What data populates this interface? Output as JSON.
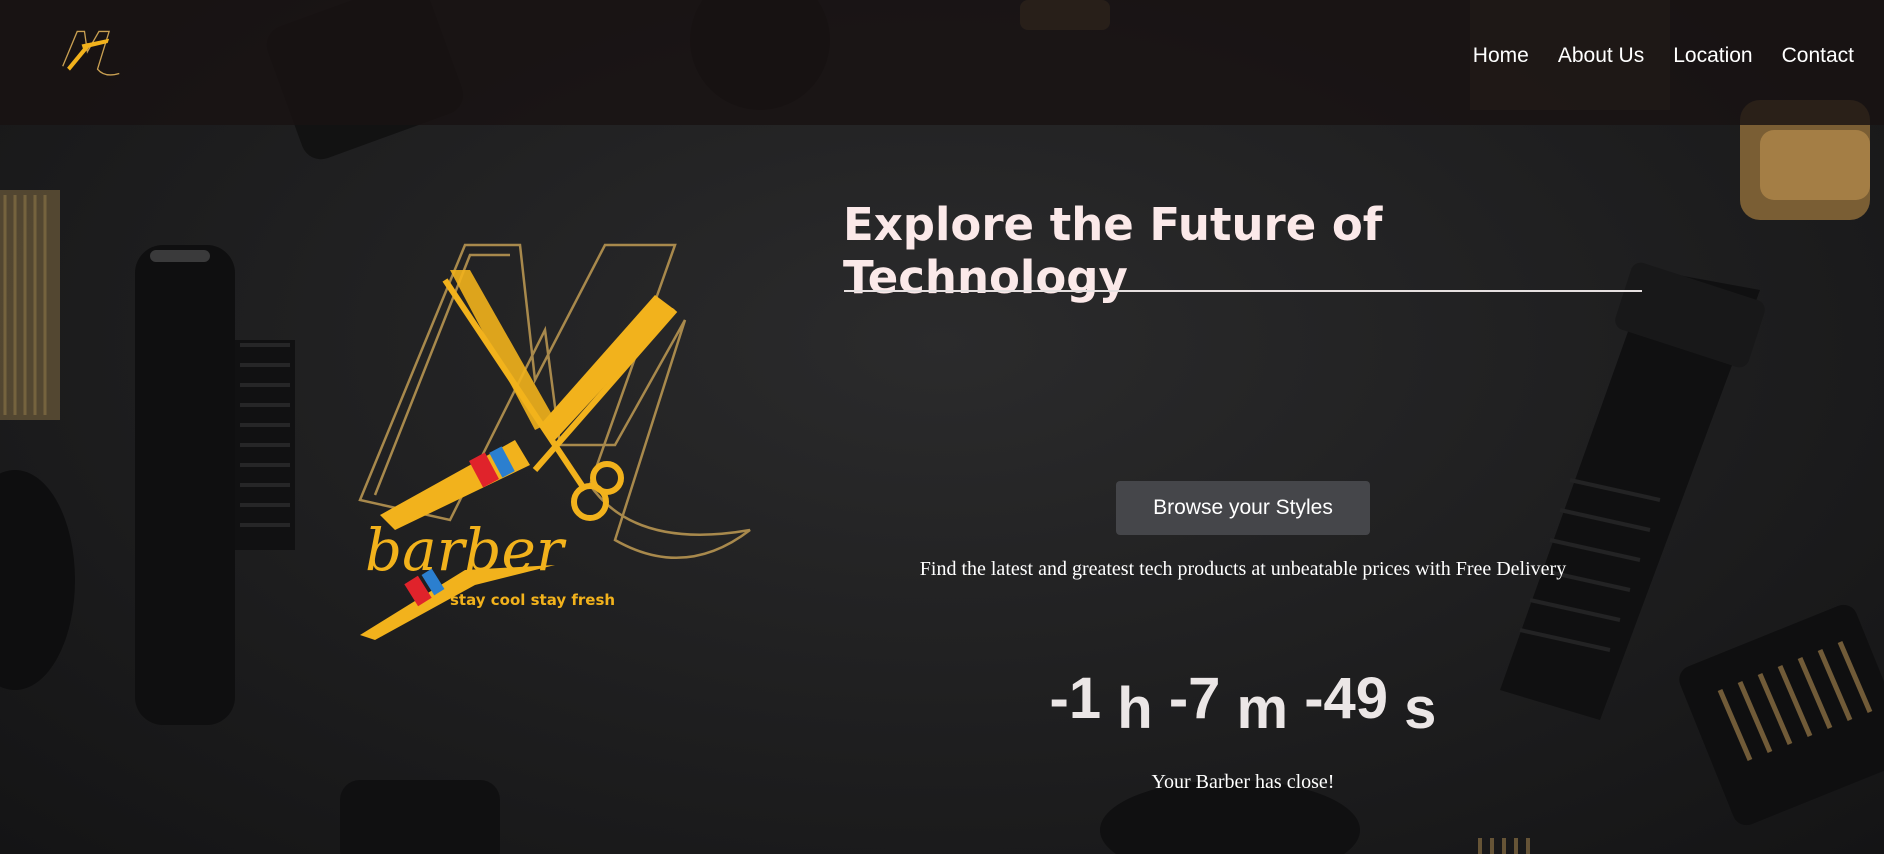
{
  "nav": {
    "logo_icon": "barber-logo",
    "links": [
      "Home",
      "About Us",
      "Location",
      "Contact"
    ]
  },
  "hero": {
    "logo_icon": "barber-logo",
    "logo_text": "barber",
    "logo_slogan": "stay cool stay fresh",
    "title": "Explore the Future of Technology",
    "button_label": "Browse your Styles",
    "tagline": "Find the latest and greatest tech products at unbeatable prices with Free Delivery",
    "countdown": {
      "hours": "-1",
      "hours_unit": "h",
      "minutes": "-7",
      "minutes_unit": "m",
      "seconds": "-49",
      "seconds_unit": "s"
    },
    "status": "Your Barber has close!"
  },
  "colors": {
    "gold": "#f2b21c",
    "title": "#fbe9e9",
    "button_bg": "#45464a"
  }
}
